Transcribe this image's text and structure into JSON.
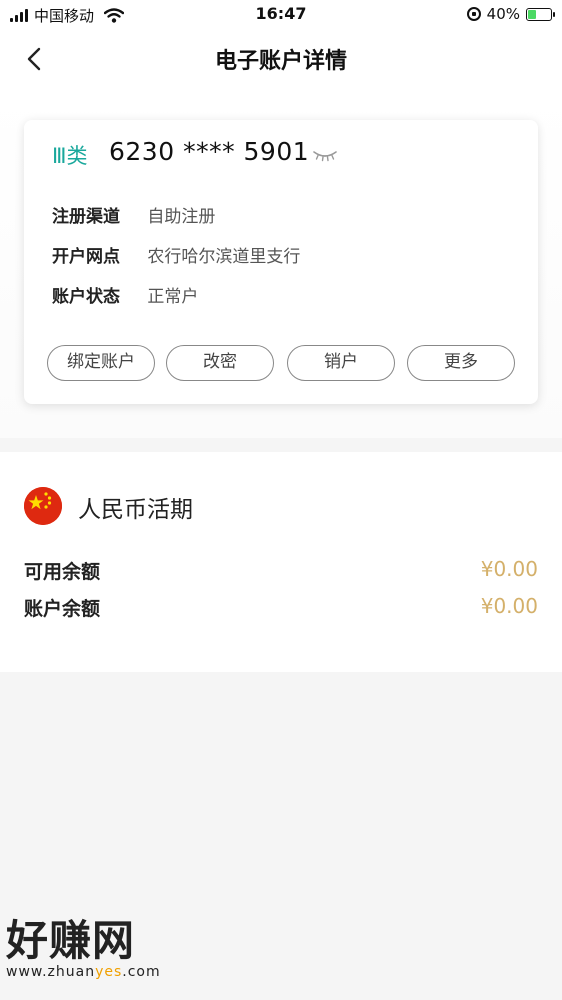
{
  "status_bar": {
    "carrier": "中国移动",
    "time": "16:47",
    "battery_percent": "40%",
    "battery_level": 0.4
  },
  "nav": {
    "title": "电子账户详情"
  },
  "account_card": {
    "type_label": "Ⅲ类",
    "account_number": "6230 **** 5901",
    "rows": [
      {
        "label": "注册渠道",
        "value": "自助注册"
      },
      {
        "label": "开户网点",
        "value": "农行哈尔滨道里支行"
      },
      {
        "label": "账户状态",
        "value": "正常户"
      }
    ],
    "buttons": [
      "绑定账户",
      "改密",
      "销户",
      "更多"
    ]
  },
  "balance": {
    "currency": "人民币活期",
    "available_label": "可用余额",
    "available_value": "¥0.00",
    "account_label": "账户余额",
    "account_value": "¥0.00"
  },
  "watermark": {
    "brand": "好赚网",
    "url_prefix": "www.zhuan",
    "url_highlight": "yes",
    "url_suffix": ".com"
  },
  "colors": {
    "accent_teal": "#1aa89c",
    "amount_gold": "#d4b06a",
    "flag_red": "#de2910",
    "flag_yellow": "#ffde00"
  }
}
